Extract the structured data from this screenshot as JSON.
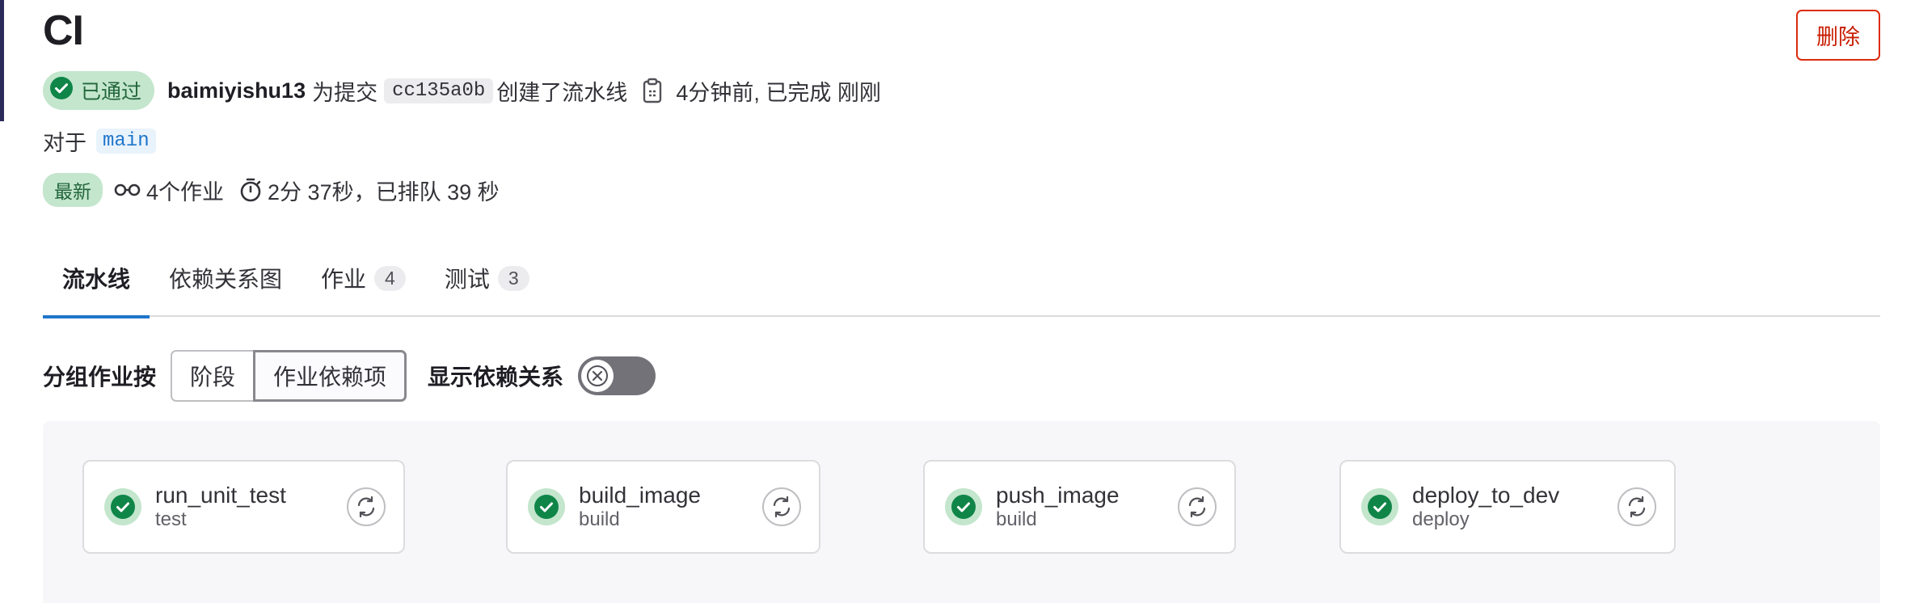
{
  "header": {
    "title": "CI",
    "delete_label": "删除"
  },
  "meta": {
    "status_label": "已通过",
    "author": "baimiyishu13",
    "for_commit_text": "为提交",
    "commit_sha": "cc135a0b",
    "created_text": "创建了流水线",
    "time_text": "4分钟前, 已完成 刚刚"
  },
  "ref": {
    "prefix": "对于",
    "branch": "main"
  },
  "info": {
    "latest_badge": "最新",
    "jobs_count_text": "4个作业",
    "duration_text": "2分 37秒，已排队 39 秒"
  },
  "tabs": [
    {
      "label": "流水线",
      "count": null
    },
    {
      "label": "依赖关系图",
      "count": null
    },
    {
      "label": "作业",
      "count": "4"
    },
    {
      "label": "测试",
      "count": "3"
    }
  ],
  "grouping": {
    "label": "分组作业按",
    "option_stage": "阶段",
    "option_needs": "作业依赖项",
    "selected": "作业依赖项",
    "show_deps_label": "显示依赖关系",
    "show_deps_enabled": false
  },
  "jobs": [
    {
      "name": "run_unit_test",
      "stage": "test",
      "status": "passed"
    },
    {
      "name": "build_image",
      "stage": "build",
      "status": "passed"
    },
    {
      "name": "push_image",
      "stage": "build",
      "status": "passed"
    },
    {
      "name": "deploy_to_dev",
      "stage": "deploy",
      "status": "passed"
    }
  ],
  "colors": {
    "success": "#108548",
    "success_bg": "#c3e6cd",
    "danger": "#dd2b0e",
    "tab_active": "#1f75cb"
  }
}
